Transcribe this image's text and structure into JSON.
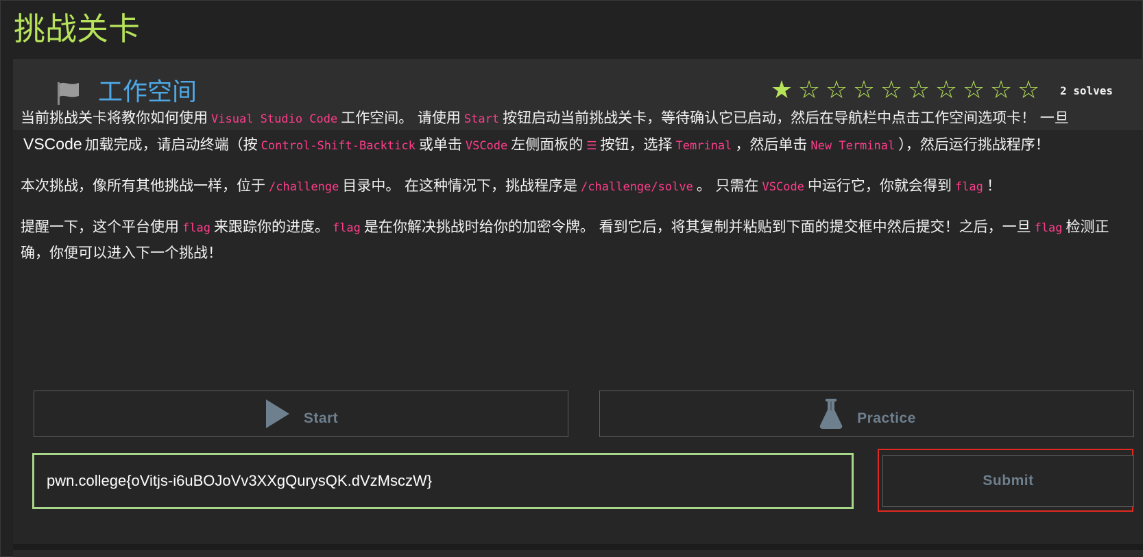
{
  "page": {
    "title": "挑战关卡"
  },
  "challenge": {
    "icon": "flag-icon",
    "title": "工作空间",
    "rating": {
      "filled": 1,
      "total": 10
    },
    "solves": "2 solves",
    "colors": {
      "accent_green": "#b6e35a",
      "title_blue": "#4fa8e6",
      "code_pink": "#ff3d8b",
      "input_border": "#a7d68a",
      "highlight_red": "#e02a1f"
    },
    "description": {
      "p1": {
        "t1": "当前挑战关卡将教你如何使用",
        "c1": "Visual Studio Code",
        "t2": "工作空间。 请使用",
        "c2": "Start",
        "t3": "按钮启动当前挑战关卡，等待确认它已启动，然后在导航栏中点击工作空间选项卡！ 一旦",
        "s1": "VSCode",
        "t4": "加载完成，请启动终端（按",
        "c3": "Control-Shift-Backtick",
        "t5": "或单击",
        "c4": "VSCode",
        "t6": "左侧面板的",
        "c5": "☰",
        "t7": "按钮，选择",
        "c6": "Temrinal",
        "t8": "，然后单击",
        "c7": "New Terminal",
        "t9": "），然后运行挑战程序！"
      },
      "p2": {
        "t1": "本次挑战，像所有其他挑战一样，位于",
        "c1": "/challenge",
        "t2": "目录中。 在这种情况下，挑战程序是",
        "c2": "/challenge/solve",
        "t3": "。 只需在",
        "c3": "VSCode",
        "t4": "中运行它，你就会得到",
        "c4": "flag",
        "t5": "！"
      },
      "p3": {
        "t1": "提醒一下，这个平台使用",
        "c1": "flag",
        "t2": "来跟踪你的进度。",
        "c2": "flag",
        "t3": "是在你解决挑战时给你的加密令牌。 看到它后，将其复制并粘贴到下面的提交框中然后提交！之后，一旦",
        "c3": "flag",
        "t4": "检测正确，你便可以进入下一个挑战！"
      }
    },
    "buttons": {
      "start": {
        "label": "Start",
        "icon": "play-icon"
      },
      "practice": {
        "label": "Practice",
        "icon": "flask-icon"
      },
      "submit": {
        "label": "Submit"
      }
    },
    "flag_input": {
      "value": "pwn.college{oVitjs-i6uBOJoVv3XXgQurysQK.dVzMsczW}"
    }
  }
}
